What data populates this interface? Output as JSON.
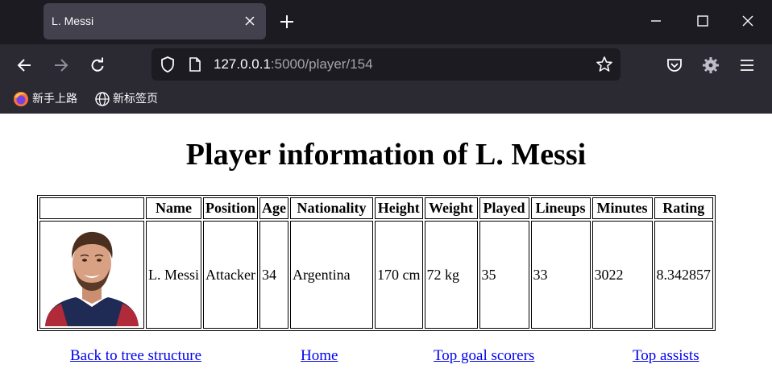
{
  "browser": {
    "tab_title": "L. Messi",
    "url_host": "127.0.0.1",
    "url_rest": ":5000/player/154",
    "bookmarks": [
      {
        "label": "新手上路",
        "icon": "firefox-icon"
      },
      {
        "label": "新标签页",
        "icon": "globe-icon"
      }
    ]
  },
  "page": {
    "title": "Player information of L. Messi",
    "table": {
      "headers": [
        "",
        "Name",
        "Position",
        "Age",
        "Nationality",
        "Height",
        "Weight",
        "Played",
        "Lineups",
        "Minutes",
        "Rating"
      ],
      "row": {
        "name": "L. Messi",
        "position": "Attacker",
        "age": "34",
        "nationality": "Argentina",
        "height": "170 cm",
        "weight": "72 kg",
        "played": "35",
        "lineups": "33",
        "minutes": "3022",
        "rating": "8.342857"
      }
    },
    "links": [
      {
        "label": "Back to tree structure"
      },
      {
        "label": "Home"
      },
      {
        "label": "Top goal scorers"
      },
      {
        "label": "Top assists"
      }
    ]
  },
  "colors": {
    "chrome_dark": "#1c1b22",
    "chrome_toolbar": "#2b2a33",
    "tab_active": "#42414d",
    "link": "#0000ee"
  }
}
